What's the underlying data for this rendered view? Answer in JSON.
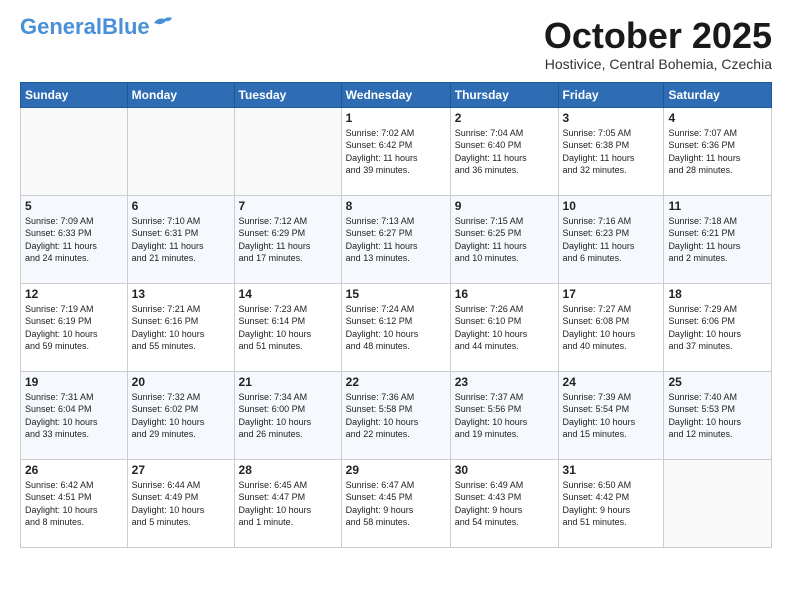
{
  "header": {
    "logo_general": "General",
    "logo_blue": "Blue",
    "month_title": "October 2025",
    "subtitle": "Hostivice, Central Bohemia, Czechia"
  },
  "days_of_week": [
    "Sunday",
    "Monday",
    "Tuesday",
    "Wednesday",
    "Thursday",
    "Friday",
    "Saturday"
  ],
  "weeks": [
    [
      {
        "day": "",
        "info": ""
      },
      {
        "day": "",
        "info": ""
      },
      {
        "day": "",
        "info": ""
      },
      {
        "day": "1",
        "info": "Sunrise: 7:02 AM\nSunset: 6:42 PM\nDaylight: 11 hours\nand 39 minutes."
      },
      {
        "day": "2",
        "info": "Sunrise: 7:04 AM\nSunset: 6:40 PM\nDaylight: 11 hours\nand 36 minutes."
      },
      {
        "day": "3",
        "info": "Sunrise: 7:05 AM\nSunset: 6:38 PM\nDaylight: 11 hours\nand 32 minutes."
      },
      {
        "day": "4",
        "info": "Sunrise: 7:07 AM\nSunset: 6:36 PM\nDaylight: 11 hours\nand 28 minutes."
      }
    ],
    [
      {
        "day": "5",
        "info": "Sunrise: 7:09 AM\nSunset: 6:33 PM\nDaylight: 11 hours\nand 24 minutes."
      },
      {
        "day": "6",
        "info": "Sunrise: 7:10 AM\nSunset: 6:31 PM\nDaylight: 11 hours\nand 21 minutes."
      },
      {
        "day": "7",
        "info": "Sunrise: 7:12 AM\nSunset: 6:29 PM\nDaylight: 11 hours\nand 17 minutes."
      },
      {
        "day": "8",
        "info": "Sunrise: 7:13 AM\nSunset: 6:27 PM\nDaylight: 11 hours\nand 13 minutes."
      },
      {
        "day": "9",
        "info": "Sunrise: 7:15 AM\nSunset: 6:25 PM\nDaylight: 11 hours\nand 10 minutes."
      },
      {
        "day": "10",
        "info": "Sunrise: 7:16 AM\nSunset: 6:23 PM\nDaylight: 11 hours\nand 6 minutes."
      },
      {
        "day": "11",
        "info": "Sunrise: 7:18 AM\nSunset: 6:21 PM\nDaylight: 11 hours\nand 2 minutes."
      }
    ],
    [
      {
        "day": "12",
        "info": "Sunrise: 7:19 AM\nSunset: 6:19 PM\nDaylight: 10 hours\nand 59 minutes."
      },
      {
        "day": "13",
        "info": "Sunrise: 7:21 AM\nSunset: 6:16 PM\nDaylight: 10 hours\nand 55 minutes."
      },
      {
        "day": "14",
        "info": "Sunrise: 7:23 AM\nSunset: 6:14 PM\nDaylight: 10 hours\nand 51 minutes."
      },
      {
        "day": "15",
        "info": "Sunrise: 7:24 AM\nSunset: 6:12 PM\nDaylight: 10 hours\nand 48 minutes."
      },
      {
        "day": "16",
        "info": "Sunrise: 7:26 AM\nSunset: 6:10 PM\nDaylight: 10 hours\nand 44 minutes."
      },
      {
        "day": "17",
        "info": "Sunrise: 7:27 AM\nSunset: 6:08 PM\nDaylight: 10 hours\nand 40 minutes."
      },
      {
        "day": "18",
        "info": "Sunrise: 7:29 AM\nSunset: 6:06 PM\nDaylight: 10 hours\nand 37 minutes."
      }
    ],
    [
      {
        "day": "19",
        "info": "Sunrise: 7:31 AM\nSunset: 6:04 PM\nDaylight: 10 hours\nand 33 minutes."
      },
      {
        "day": "20",
        "info": "Sunrise: 7:32 AM\nSunset: 6:02 PM\nDaylight: 10 hours\nand 29 minutes."
      },
      {
        "day": "21",
        "info": "Sunrise: 7:34 AM\nSunset: 6:00 PM\nDaylight: 10 hours\nand 26 minutes."
      },
      {
        "day": "22",
        "info": "Sunrise: 7:36 AM\nSunset: 5:58 PM\nDaylight: 10 hours\nand 22 minutes."
      },
      {
        "day": "23",
        "info": "Sunrise: 7:37 AM\nSunset: 5:56 PM\nDaylight: 10 hours\nand 19 minutes."
      },
      {
        "day": "24",
        "info": "Sunrise: 7:39 AM\nSunset: 5:54 PM\nDaylight: 10 hours\nand 15 minutes."
      },
      {
        "day": "25",
        "info": "Sunrise: 7:40 AM\nSunset: 5:53 PM\nDaylight: 10 hours\nand 12 minutes."
      }
    ],
    [
      {
        "day": "26",
        "info": "Sunrise: 6:42 AM\nSunset: 4:51 PM\nDaylight: 10 hours\nand 8 minutes."
      },
      {
        "day": "27",
        "info": "Sunrise: 6:44 AM\nSunset: 4:49 PM\nDaylight: 10 hours\nand 5 minutes."
      },
      {
        "day": "28",
        "info": "Sunrise: 6:45 AM\nSunset: 4:47 PM\nDaylight: 10 hours\nand 1 minute."
      },
      {
        "day": "29",
        "info": "Sunrise: 6:47 AM\nSunset: 4:45 PM\nDaylight: 9 hours\nand 58 minutes."
      },
      {
        "day": "30",
        "info": "Sunrise: 6:49 AM\nSunset: 4:43 PM\nDaylight: 9 hours\nand 54 minutes."
      },
      {
        "day": "31",
        "info": "Sunrise: 6:50 AM\nSunset: 4:42 PM\nDaylight: 9 hours\nand 51 minutes."
      },
      {
        "day": "",
        "info": ""
      }
    ]
  ]
}
